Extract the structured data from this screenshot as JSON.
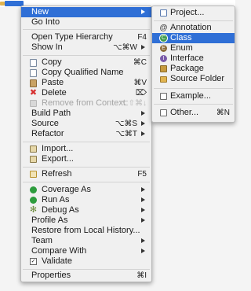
{
  "colors": {
    "selection": "#2f6fd6",
    "menu_bg": "#f0f0f0",
    "disabled": "#a4a4a4",
    "delete_red": "#d62f2f",
    "run_green": "#2d9c3d"
  },
  "context_menu": {
    "new": {
      "label": "New"
    },
    "go_into": {
      "label": "Go Into"
    },
    "open_type_hierarchy": {
      "label": "Open Type Hierarchy",
      "shortcut": "F4"
    },
    "show_in": {
      "label": "Show In",
      "shortcut": "⌥⌘W"
    },
    "copy": {
      "label": "Copy",
      "shortcut": "⌘C",
      "icon": "copy-icon"
    },
    "copy_qualified_name": {
      "label": "Copy Qualified Name",
      "icon": "copy-icon"
    },
    "paste": {
      "label": "Paste",
      "shortcut": "⌘V",
      "icon": "paste-icon"
    },
    "delete": {
      "label": "Delete",
      "shortcut": "⌦",
      "icon": "delete-icon"
    },
    "remove_from_context": {
      "label": "Remove from Context",
      "shortcut": "⌥⇧⌘↓",
      "icon": "remove-context-icon"
    },
    "build_path": {
      "label": "Build Path"
    },
    "source": {
      "label": "Source",
      "shortcut": "⌥⌘S"
    },
    "refactor": {
      "label": "Refactor",
      "shortcut": "⌥⌘T"
    },
    "import": {
      "label": "Import...",
      "icon": "import-icon"
    },
    "export": {
      "label": "Export...",
      "icon": "export-icon"
    },
    "refresh": {
      "label": "Refresh",
      "shortcut": "F5",
      "icon": "refresh-icon"
    },
    "coverage_as": {
      "label": "Coverage As",
      "icon": "coverage-icon"
    },
    "run_as": {
      "label": "Run As",
      "icon": "run-icon"
    },
    "debug_as": {
      "label": "Debug As",
      "icon": "debug-icon"
    },
    "profile_as": {
      "label": "Profile As"
    },
    "restore_from_local_history": {
      "label": "Restore from Local History..."
    },
    "team": {
      "label": "Team"
    },
    "compare_with": {
      "label": "Compare With"
    },
    "validate": {
      "label": "Validate",
      "icon": "validate-icon"
    },
    "properties": {
      "label": "Properties",
      "shortcut": "⌘I"
    }
  },
  "submenu": {
    "project": {
      "label": "Project...",
      "icon": "project-icon"
    },
    "annotation": {
      "label": "Annotation",
      "icon": "annotation-icon"
    },
    "class": {
      "label": "Class",
      "icon": "class-icon"
    },
    "enum": {
      "label": "Enum",
      "icon": "enum-icon"
    },
    "interface": {
      "label": "Interface",
      "icon": "interface-icon"
    },
    "package": {
      "label": "Package",
      "icon": "package-icon"
    },
    "source_folder": {
      "label": "Source Folder",
      "icon": "source-folder-icon"
    },
    "example": {
      "label": "Example...",
      "icon": "example-icon"
    },
    "other": {
      "label": "Other...",
      "shortcut": "⌘N",
      "icon": "other-icon"
    }
  }
}
